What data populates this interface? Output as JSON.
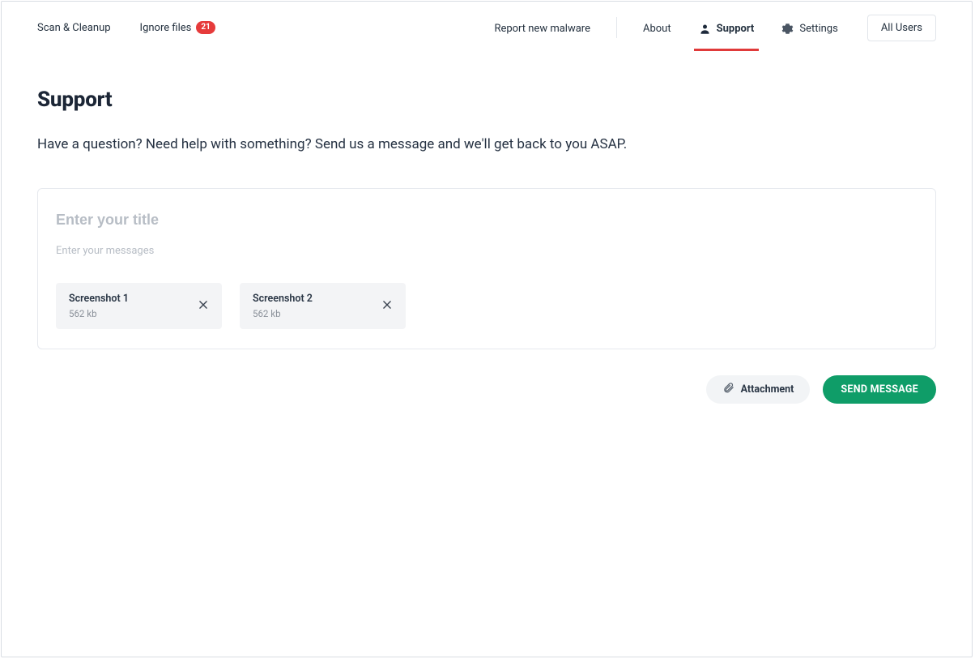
{
  "nav": {
    "left": {
      "scan_cleanup": "Scan & Cleanup",
      "ignore_files": "Ignore files",
      "ignore_badge": "21"
    },
    "right": {
      "report_malware": "Report new malware",
      "about": "About",
      "support": "Support",
      "settings": "Settings"
    },
    "user_select": "All Users"
  },
  "page": {
    "title": "Support",
    "subtitle": "Have a question? Need help with something? Send us a message and we'll get back to you ASAP."
  },
  "form": {
    "title_placeholder": "Enter your title",
    "title_value": "",
    "message_placeholder": "Enter your messages",
    "message_value": ""
  },
  "attachments": [
    {
      "name": "Screenshot 1",
      "size": "562 kb"
    },
    {
      "name": "Screenshot 2",
      "size": "562 kb"
    }
  ],
  "actions": {
    "attachment": "Attachment",
    "send": "SEND MESSAGE"
  },
  "icons": {
    "user": "user-icon",
    "gear": "gear-icon",
    "close": "close-icon",
    "paperclip": "paperclip-icon"
  },
  "colors": {
    "accent_red": "#e03a3a",
    "primary_green": "#0f9d68",
    "text_dark": "#1e2a3b"
  }
}
